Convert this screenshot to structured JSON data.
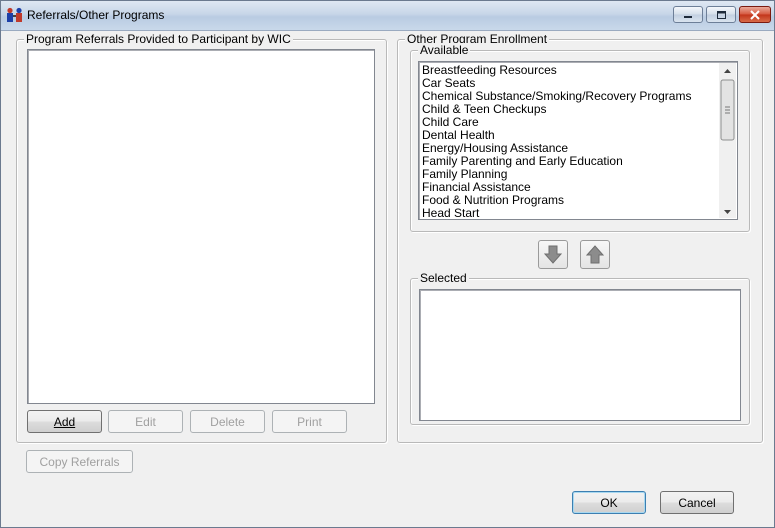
{
  "window": {
    "title": "Referrals/Other Programs"
  },
  "referrals": {
    "group_label": "Program Referrals Provided to Participant by WIC",
    "buttons": {
      "add": "Add",
      "edit": "Edit",
      "delete": "Delete",
      "print": "Print",
      "copy": "Copy Referrals"
    }
  },
  "enrollment": {
    "group_label": "Other Program Enrollment",
    "available_label": "Available",
    "available_items": [
      "Breastfeeding Resources",
      "Car Seats",
      "Chemical Substance/Smoking/Recovery Programs",
      "Child & Teen Checkups",
      "Child Care",
      "Dental Health",
      "Energy/Housing Assistance",
      "Family Parenting and Early Education",
      "Family Planning",
      "Financial Assistance",
      "Food & Nutrition Programs",
      "Head Start"
    ],
    "selected_label": "Selected"
  },
  "footer": {
    "ok": "OK",
    "cancel": "Cancel"
  },
  "icons": {
    "move_down": "arrow-down-icon",
    "move_up": "arrow-up-icon",
    "app": "people-icon"
  }
}
